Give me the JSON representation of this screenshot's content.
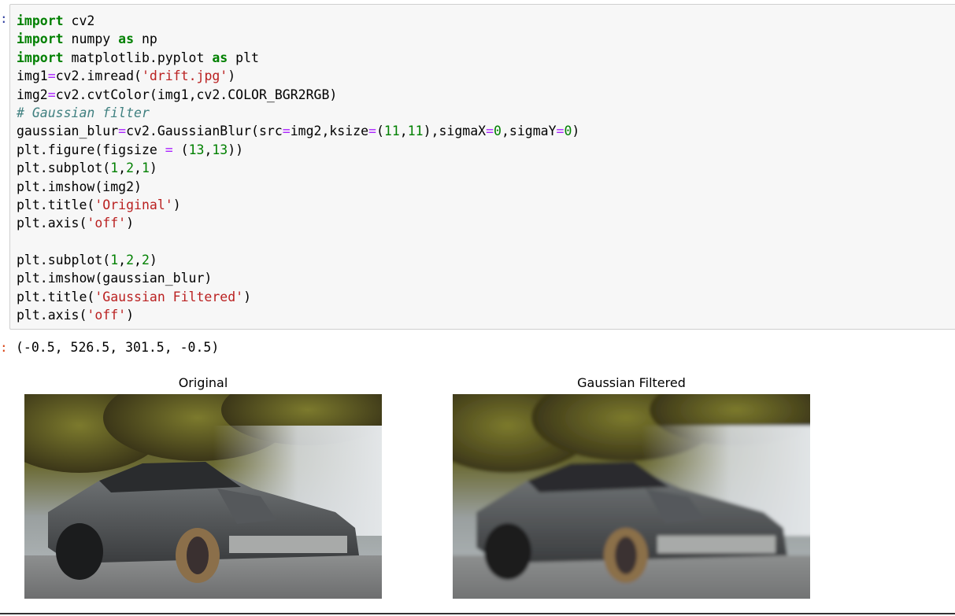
{
  "notebook": {
    "input_prompt": "In [ ]:",
    "output_prompt": "Out[ ]:"
  },
  "code_cell": {
    "lines": [
      [
        {
          "t": "kw",
          "v": "import"
        },
        {
          "t": "p",
          "v": " cv2"
        }
      ],
      [
        {
          "t": "kw",
          "v": "import"
        },
        {
          "t": "p",
          "v": " numpy "
        },
        {
          "t": "kw",
          "v": "as"
        },
        {
          "t": "p",
          "v": " np"
        }
      ],
      [
        {
          "t": "kw",
          "v": "import"
        },
        {
          "t": "p",
          "v": " matplotlib.pyplot "
        },
        {
          "t": "kw",
          "v": "as"
        },
        {
          "t": "p",
          "v": " plt"
        }
      ],
      [
        {
          "t": "p",
          "v": "img1"
        },
        {
          "t": "op",
          "v": "="
        },
        {
          "t": "p",
          "v": "cv2.imread("
        },
        {
          "t": "str",
          "v": "'drift.jpg'"
        },
        {
          "t": "p",
          "v": ")"
        }
      ],
      [
        {
          "t": "p",
          "v": "img2"
        },
        {
          "t": "op",
          "v": "="
        },
        {
          "t": "p",
          "v": "cv2.cvtColor(img1,cv2.COLOR_BGR2RGB)"
        }
      ],
      [
        {
          "t": "cm",
          "v": "# Gaussian filter"
        }
      ],
      [
        {
          "t": "p",
          "v": "gaussian_blur"
        },
        {
          "t": "op",
          "v": "="
        },
        {
          "t": "p",
          "v": "cv2.GaussianBlur(src"
        },
        {
          "t": "op",
          "v": "="
        },
        {
          "t": "p",
          "v": "img2,ksize"
        },
        {
          "t": "op",
          "v": "="
        },
        {
          "t": "p",
          "v": "("
        },
        {
          "t": "num",
          "v": "11"
        },
        {
          "t": "p",
          "v": ","
        },
        {
          "t": "num",
          "v": "11"
        },
        {
          "t": "p",
          "v": "),sigmaX"
        },
        {
          "t": "op",
          "v": "="
        },
        {
          "t": "num",
          "v": "0"
        },
        {
          "t": "p",
          "v": ",sigmaY"
        },
        {
          "t": "op",
          "v": "="
        },
        {
          "t": "num",
          "v": "0"
        },
        {
          "t": "p",
          "v": ")"
        }
      ],
      [
        {
          "t": "p",
          "v": "plt.figure(figsize "
        },
        {
          "t": "op",
          "v": "="
        },
        {
          "t": "p",
          "v": " ("
        },
        {
          "t": "num",
          "v": "13"
        },
        {
          "t": "p",
          "v": ","
        },
        {
          "t": "num",
          "v": "13"
        },
        {
          "t": "p",
          "v": "))"
        }
      ],
      [
        {
          "t": "p",
          "v": "plt.subplot("
        },
        {
          "t": "num",
          "v": "1"
        },
        {
          "t": "p",
          "v": ","
        },
        {
          "t": "num",
          "v": "2"
        },
        {
          "t": "p",
          "v": ","
        },
        {
          "t": "num",
          "v": "1"
        },
        {
          "t": "p",
          "v": ")"
        }
      ],
      [
        {
          "t": "p",
          "v": "plt.imshow(img2)"
        }
      ],
      [
        {
          "t": "p",
          "v": "plt.title("
        },
        {
          "t": "str",
          "v": "'Original'"
        },
        {
          "t": "p",
          "v": ")"
        }
      ],
      [
        {
          "t": "p",
          "v": "plt.axis("
        },
        {
          "t": "str",
          "v": "'off'"
        },
        {
          "t": "p",
          "v": ")"
        }
      ],
      [
        {
          "t": "p",
          "v": " "
        }
      ],
      [
        {
          "t": "p",
          "v": "plt.subplot("
        },
        {
          "t": "num",
          "v": "1"
        },
        {
          "t": "p",
          "v": ","
        },
        {
          "t": "num",
          "v": "2"
        },
        {
          "t": "p",
          "v": ","
        },
        {
          "t": "num",
          "v": "2"
        },
        {
          "t": "p",
          "v": ")"
        }
      ],
      [
        {
          "t": "p",
          "v": "plt.imshow(gaussian_blur)"
        }
      ],
      [
        {
          "t": "p",
          "v": "plt.title("
        },
        {
          "t": "str",
          "v": "'Gaussian Filtered'"
        },
        {
          "t": "p",
          "v": ")"
        }
      ],
      [
        {
          "t": "p",
          "v": "plt.axis("
        },
        {
          "t": "str",
          "v": "'off'"
        },
        {
          "t": "p",
          "v": ")"
        }
      ]
    ]
  },
  "output": {
    "text": "(-0.5, 526.5, 301.5, -0.5)"
  },
  "figures": {
    "left_title": "Original",
    "right_title": "Gaussian Filtered"
  },
  "colors": {
    "keyword": "#008000",
    "string": "#ba2121",
    "number": "#008000",
    "operator": "#aa22ff",
    "comment": "#408080",
    "cell_background": "#f7f7f7",
    "cell_border": "#cfcfcf"
  }
}
